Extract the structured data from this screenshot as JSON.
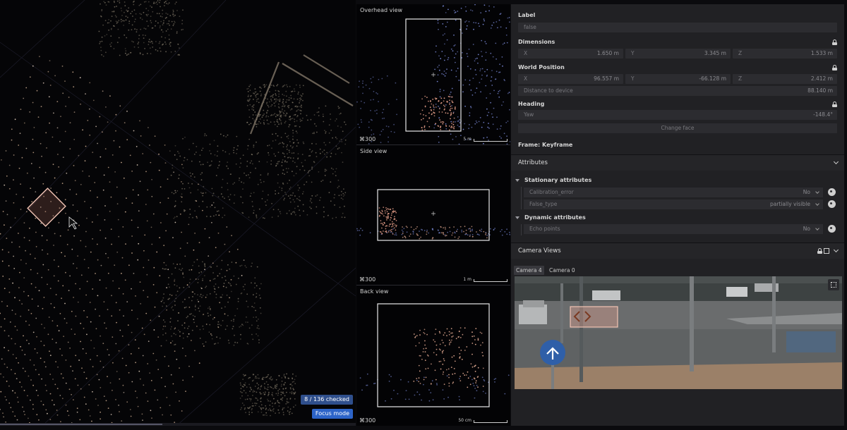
{
  "viewport": {
    "checked_badge": "8 / 136 checked",
    "focus_mode": "Focus mode"
  },
  "views": {
    "overhead": {
      "title": "Overhead view",
      "zoom": "⌘300",
      "scale": "5 m"
    },
    "side": {
      "title": "Side view",
      "zoom": "⌘300",
      "scale": "1 m"
    },
    "back": {
      "title": "Back view",
      "zoom": "⌘300",
      "scale": "50 cm"
    }
  },
  "panel": {
    "label": {
      "title": "Label",
      "value": "false"
    },
    "dimensions": {
      "title": "Dimensions",
      "x": {
        "key": "X",
        "value": "1.650 m"
      },
      "y": {
        "key": "Y",
        "value": "3.345 m"
      },
      "z": {
        "key": "Z",
        "value": "1.533 m"
      }
    },
    "world_position": {
      "title": "World Position",
      "x": {
        "key": "X",
        "value": "96.557 m"
      },
      "y": {
        "key": "Y",
        "value": "-66.128 m"
      },
      "z": {
        "key": "Z",
        "value": "2.412 m"
      },
      "distance": {
        "key": "Distance to device",
        "value": "88.140 m"
      }
    },
    "heading": {
      "title": "Heading",
      "yaw": {
        "key": "Yaw",
        "value": "-148.4°"
      },
      "change_face": "Change face"
    },
    "frame": "Frame: Keyframe",
    "attributes": {
      "title": "Attributes",
      "stationary": {
        "title": "Stationary attributes",
        "rows": [
          {
            "key": "Calibration_error",
            "value": "No"
          },
          {
            "key": "False_type",
            "value": "partially visible"
          }
        ]
      },
      "dynamic": {
        "title": "Dynamic attributes",
        "rows": [
          {
            "key": "Echo points",
            "value": "No"
          }
        ]
      }
    },
    "camera_views": {
      "title": "Camera Views",
      "tabs": [
        "Camera 4",
        "Camera 0"
      ],
      "active_tab": "Camera 4"
    }
  },
  "colors": {
    "accent_blue": "#2d64c8",
    "panel_bg": "#212124",
    "point_warm": "#d9b79a",
    "point_blue": "#7f8fe0",
    "bbox": "#f1c3b3"
  }
}
